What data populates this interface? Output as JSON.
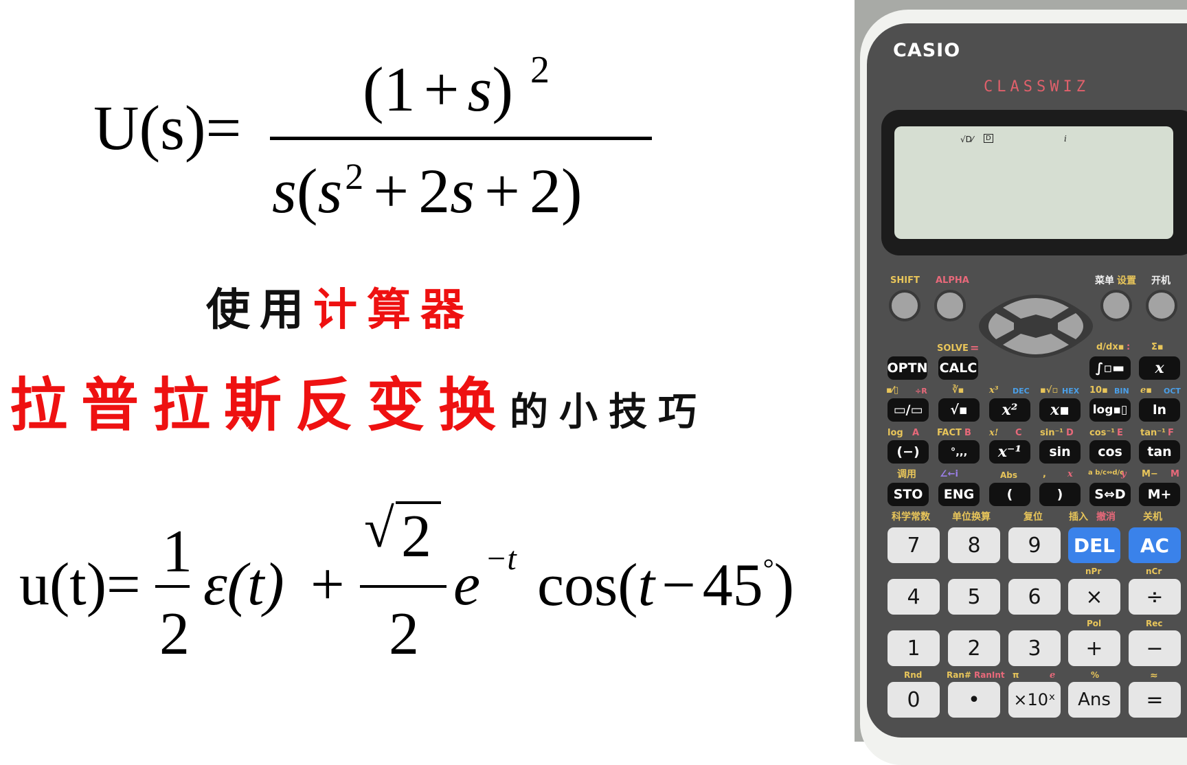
{
  "equation_top": {
    "lhs": "U(s)=",
    "numerator": {
      "open": "(",
      "one": "1",
      "plus": "+",
      "s": "s",
      "close": ")",
      "exp": "2"
    },
    "denominator": {
      "s": "s",
      "open": "(",
      "s2": "s",
      "exp": "2",
      "plus1": "+",
      "two_s": "2",
      "s3": "s",
      "plus2": "+",
      "two": "2",
      "close": ")"
    }
  },
  "title": {
    "line1_black": "使用",
    "line1_red": "计算器",
    "line2_red": "拉普拉斯反变换",
    "line2_black": "的小技巧"
  },
  "equation_bottom": {
    "lhs": "u(t)=",
    "frac1_num": "1",
    "frac1_den": "2",
    "eps": "ε(t)",
    "plus": "+",
    "frac2_num_radicand": "2",
    "frac2_den": "2",
    "e": "e",
    "exp": "−t",
    "cos": "cos(",
    "t": "t",
    "minus": "−",
    "angle": "45",
    "deg": "°",
    "close": ")"
  },
  "calculator": {
    "brand": "CASIO",
    "model": "CLASSWIZ",
    "display": {
      "indicator_math": "√D⁄",
      "indicator_deg": "D",
      "indicator_complex": "i"
    },
    "top_labels": {
      "shift": "SHIFT",
      "alpha": "ALPHA",
      "menu": "菜单",
      "setup": "设置",
      "on": "开机"
    },
    "row_optn": {
      "solve": "SOLVE",
      "eq": "=",
      "optn": "OPTN",
      "calc": "CALC",
      "ddx": "d/dx▪",
      "colon": ":",
      "sigma": "Σ▪",
      "integral": "∫▫▬",
      "x": "x"
    },
    "row_frac": {
      "mixed": "▪⁄▯",
      "divr": "÷R",
      "cbrt": "∛▪",
      "x3": "x³",
      "dec": "DEC",
      "xroot": "▪√▫",
      "hex": "HEX",
      "pow10": "10▪",
      "bin": "BIN",
      "exp": "e▪",
      "oct": "OCT",
      "keys": [
        "▭/▭",
        "√▪",
        "x²",
        "x▪",
        "log▪▯",
        "ln"
      ]
    },
    "row_sin": {
      "log": "log",
      "A": "A",
      "fact": "FACT",
      "B": "B",
      "xfact": "x!",
      "C": "C",
      "asin": "sin⁻¹",
      "D": "D",
      "acos": "cos⁻¹",
      "E": "E",
      "atan": "tan⁻¹",
      "F": "F",
      "keys": [
        "(−)",
        "°,,,",
        "x⁻¹",
        "sin",
        "cos",
        "tan"
      ]
    },
    "row_sto": {
      "recall": "调用",
      "angle": "∠←i",
      "abs": "Abs",
      "comma": ",",
      "xvar": "x",
      "abc": "a b/c⇔d/c",
      "yvar": "y",
      "mminus": "M−",
      "mvar": "M",
      "keys": [
        "STO",
        "ENG",
        "(",
        ")",
        "S⇔D",
        "M+"
      ]
    },
    "row_7": {
      "labels": [
        "科学常数",
        "单位换算",
        "复位",
        "插入",
        "撤消",
        "关机"
      ],
      "keys": [
        "7",
        "8",
        "9",
        "DEL",
        "AC"
      ]
    },
    "row_4": {
      "labels": [
        "nPr",
        "nCr"
      ],
      "keys": [
        "4",
        "5",
        "6",
        "×",
        "÷"
      ]
    },
    "row_1": {
      "labels": [
        "Pol",
        "Rec"
      ],
      "keys": [
        "1",
        "2",
        "3",
        "+",
        "−"
      ]
    },
    "row_0": {
      "labels": [
        "Rnd",
        "Ran#",
        "RanInt",
        "π",
        "e",
        "%",
        "≈"
      ],
      "keys": [
        "0",
        "•",
        "×10ˣ",
        "Ans",
        "="
      ]
    },
    "colors": {
      "body": "#4f4f4f",
      "lcd": "#d6ded2",
      "blue_key": "#3a82ea",
      "shift_label": "#e8c55a",
      "alpha_label": "#e8697a",
      "mode_label": "#4a9fe8"
    }
  }
}
